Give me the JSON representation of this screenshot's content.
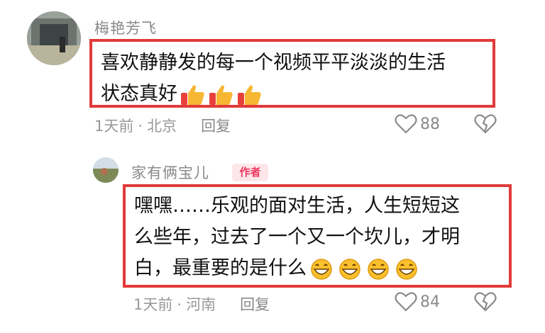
{
  "comment": {
    "username": "梅艳芳飞",
    "text_lines": [
      "喜欢静静发的每一个视频平平淡淡的生活",
      "状态真好"
    ],
    "emoji": "thumbs-up-icon",
    "time": "1天前",
    "location": "北京",
    "reply_label": "回复",
    "likes": "88"
  },
  "reply": {
    "username": "家有俩宝儿",
    "badge": "作者",
    "text_lines": [
      "嘿嘿……乐观的面对生活，人生短短这",
      "么些年，过去了一个又一个坎儿，才明",
      "白，最重要的是什么"
    ],
    "emoji": "grinning-face-icon",
    "time": "1天前",
    "location": "河南",
    "reply_label": "回复",
    "likes": "84"
  },
  "colors": {
    "highlight_border": "#e23a3a",
    "badge_bg": "#fde6ea",
    "badge_text": "#f0355d"
  }
}
